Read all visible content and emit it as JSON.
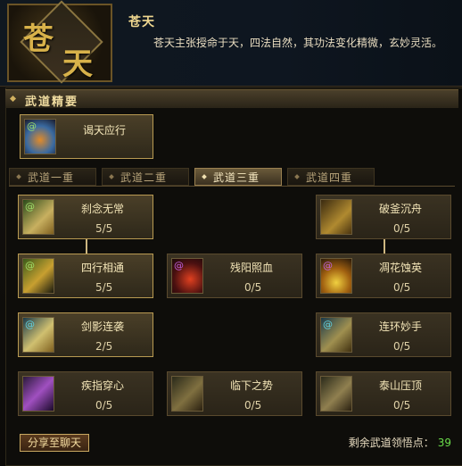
{
  "header": {
    "emblem_chars": [
      "苍",
      "天"
    ],
    "title": "苍天",
    "description": "苍天主张授命于天，四法自然，其功法变化精微，玄妙灵活。"
  },
  "panel": {
    "title": "武道精要",
    "core_skill": {
      "name": "谒天应行"
    }
  },
  "tabs": [
    {
      "label": "武道一重",
      "selected": false
    },
    {
      "label": "武道二重",
      "selected": false
    },
    {
      "label": "武道三重",
      "selected": true
    },
    {
      "label": "武道四重",
      "selected": false
    }
  ],
  "skills": [
    {
      "name": "刹念无常",
      "level": "5/5",
      "active": true
    },
    {
      "name": "破釜沉舟",
      "level": "0/5",
      "active": false
    },
    {
      "name": "四行相通",
      "level": "5/5",
      "active": true
    },
    {
      "name": "残阳照血",
      "level": "0/5",
      "active": false
    },
    {
      "name": "凋花蚀英",
      "level": "0/5",
      "active": false
    },
    {
      "name": "剑影连袭",
      "level": "2/5",
      "active": true
    },
    {
      "name": "连环妙手",
      "level": "0/5",
      "active": false
    },
    {
      "name": "疾指穿心",
      "level": "0/5",
      "active": false
    },
    {
      "name": "临下之势",
      "level": "0/5",
      "active": false
    },
    {
      "name": "泰山压顶",
      "level": "0/5",
      "active": false
    }
  ],
  "footer": {
    "share_label": "分享至聊天",
    "points_label": "剩余武道领悟点：",
    "points_value": "39"
  },
  "colors": {
    "accent": "#b89a52",
    "points": "#6adc4a",
    "bg": "#0b0a08"
  }
}
